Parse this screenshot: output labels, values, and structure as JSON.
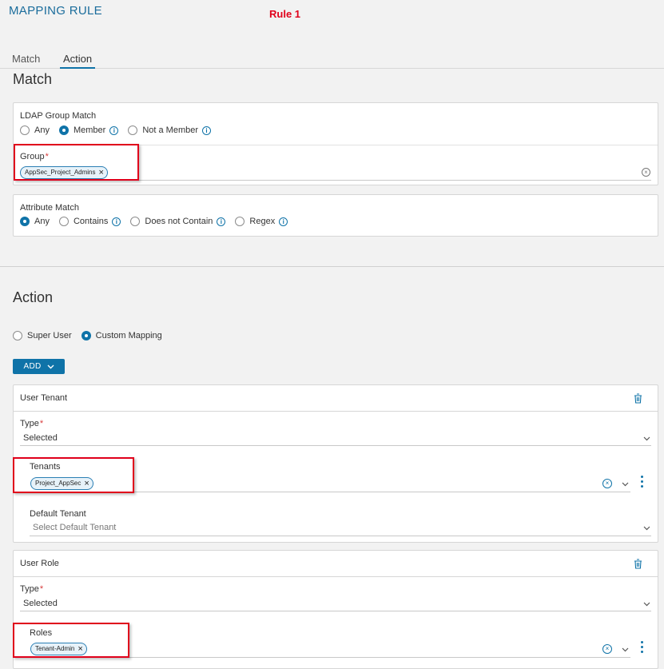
{
  "header": {
    "title": "MAPPING RULE",
    "rule_label": "Rule 1"
  },
  "tabs": [
    {
      "label": "Match"
    },
    {
      "label": "Action"
    }
  ],
  "match": {
    "heading": "Match",
    "ldap": {
      "title": "LDAP Group Match",
      "options": [
        "Any",
        "Member",
        "Not a Member"
      ],
      "selected": "Member",
      "group_label": "Group",
      "required_mark": "*",
      "group_chip": "AppSec_Project_Admins"
    },
    "attribute": {
      "title": "Attribute Match",
      "options": [
        "Any",
        "Contains",
        "Does not Contain",
        "Regex"
      ],
      "selected": "Any"
    }
  },
  "action": {
    "heading": "Action",
    "mode_options": [
      "Super User",
      "Custom Mapping"
    ],
    "mode_selected": "Custom Mapping",
    "add_label": "ADD",
    "user_tenant": {
      "title": "User Tenant",
      "type_label": "Type",
      "type_value": "Selected",
      "tenants_label": "Tenants",
      "tenant_chip": "Project_AppSec",
      "default_label": "Default Tenant",
      "default_placeholder": "Select Default Tenant"
    },
    "user_role": {
      "title": "User Role",
      "type_label": "Type",
      "type_value": "Selected",
      "roles_label": "Roles",
      "role_chip": "Tenant-Admin"
    }
  },
  "colors": {
    "accent": "#0f73a8",
    "highlight": "#e0001b"
  },
  "icons": [
    "info-icon",
    "close-icon",
    "clear-icon",
    "chevron-down-icon",
    "trash-icon",
    "kebab-icon"
  ]
}
